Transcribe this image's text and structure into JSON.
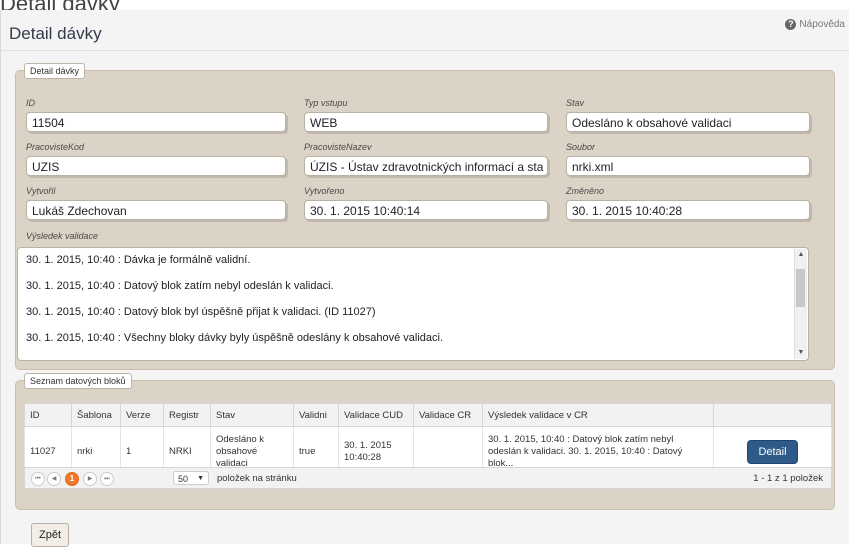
{
  "page": {
    "title": "Detail dávky",
    "help_label": "Nápověda",
    "help_icon": "question-circle-icon",
    "top_fragment": "Detail dávky"
  },
  "detail": {
    "legend": "Detail dávky",
    "fields": {
      "id": {
        "label": "ID",
        "value": "11504"
      },
      "typ_vstupu": {
        "label": "Typ vstupu",
        "value": "WEB"
      },
      "stav": {
        "label": "Stav",
        "value": "Odesláno k obsahové validaci"
      },
      "pracoviste_kod": {
        "label": "PracovisteKod",
        "value": "UZIS"
      },
      "pracoviste_nazev": {
        "label": "PracovisteNazev",
        "value": "ÚZIS - Ústav zdravotnických informací a sta"
      },
      "soubor": {
        "label": "Soubor",
        "value": "nrki.xml"
      },
      "vytvoril": {
        "label": "Vytvořil",
        "value": "Lukáš Zdechovan"
      },
      "vytvoreno": {
        "label": "Vytvořeno",
        "value": "30. 1. 2015 10:40:14"
      },
      "zmeneno": {
        "label": "Změněno",
        "value": "30. 1. 2015 10:40:28"
      }
    },
    "validation": {
      "label": "Výsledek validace",
      "lines": [
        "30. 1. 2015, 10:40 : Dávka je formálně validní.",
        "30. 1. 2015, 10:40 : Datový blok zatím nebyl odeslán k validaci.",
        "30. 1. 2015, 10:40 : Datový blok byl úspěšně přijat k validaci. (ID 11027)",
        "30. 1. 2015, 10:40 : Všechny bloky dávky byly úspěšně odeslány k obsahové validaci."
      ]
    }
  },
  "blocks": {
    "legend": "Seznam datových bloků",
    "columns": [
      "ID",
      "Šablona",
      "Verze",
      "Registr",
      "Stav",
      "Validni",
      "Validace CUD",
      "Validace CR",
      "Výsledek validace v CR",
      ""
    ],
    "rows": [
      {
        "id": "11027",
        "sablona": "nrki",
        "verze": "1",
        "registr": "NRKI",
        "stav": "Odesláno k obsahové validaci",
        "validni": "true",
        "validace_cud": "30. 1. 2015 10:40:28",
        "validace_cr": "",
        "vysledek": "30. 1. 2015, 10:40 : Datový blok zatím nebyl odeslán k validaci. 30. 1. 2015, 10:40 : Datový blok...",
        "action": "Detail"
      }
    ],
    "pager": {
      "current_page": "1",
      "page_size": "50",
      "page_size_label": "položek na stránku",
      "info": "1 - 1 z 1 položek",
      "nav_icons": [
        "first-page-icon",
        "prev-page-icon",
        "next-page-icon",
        "last-page-icon"
      ]
    }
  },
  "footer": {
    "back_label": "Zpět"
  },
  "colors": {
    "panel_bg": "#dbd3c6",
    "detail_button": "#2e5a8a",
    "pager_current": "#f07a2a"
  }
}
